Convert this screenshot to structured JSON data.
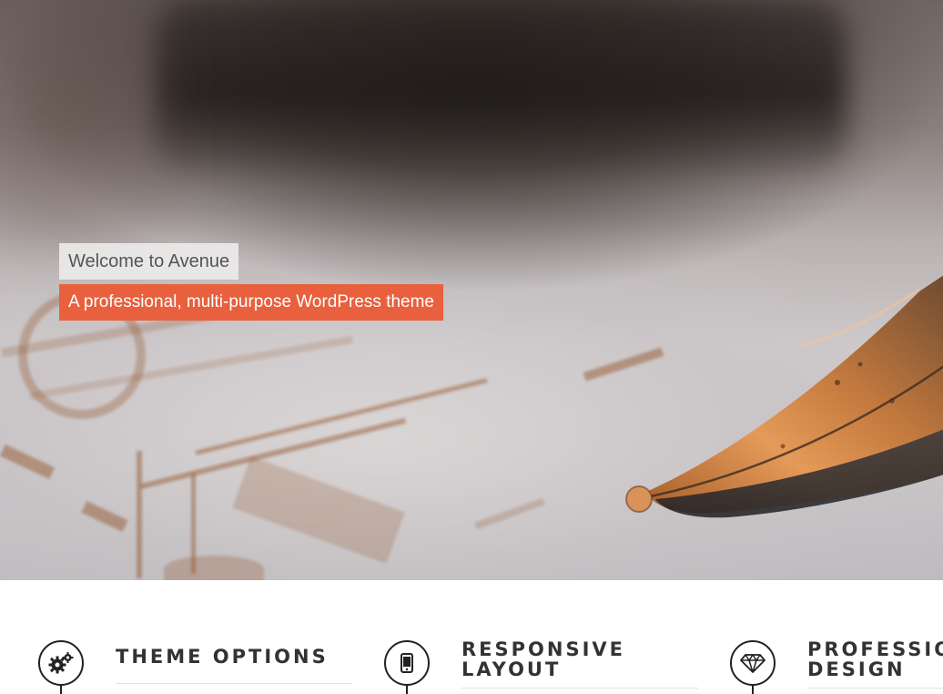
{
  "hero": {
    "welcome_text": "Welcome to Avenue",
    "tagline_text": "A professional, multi-purpose WordPress theme",
    "accent_color": "#e8603e"
  },
  "features": [
    {
      "title": "THEME OPTIONS",
      "icon": "gears-icon"
    },
    {
      "title": "RESPONSIVE LAYOUT",
      "title_line1": "RESPONSIVE",
      "title_line2": "LAYOUT",
      "icon": "mobile-icon"
    },
    {
      "title": "PROFESSIONAL DESIGN",
      "title_line1": "PROFESSIONAL",
      "title_line2": "DESIGN",
      "icon": "diamond-icon"
    }
  ]
}
